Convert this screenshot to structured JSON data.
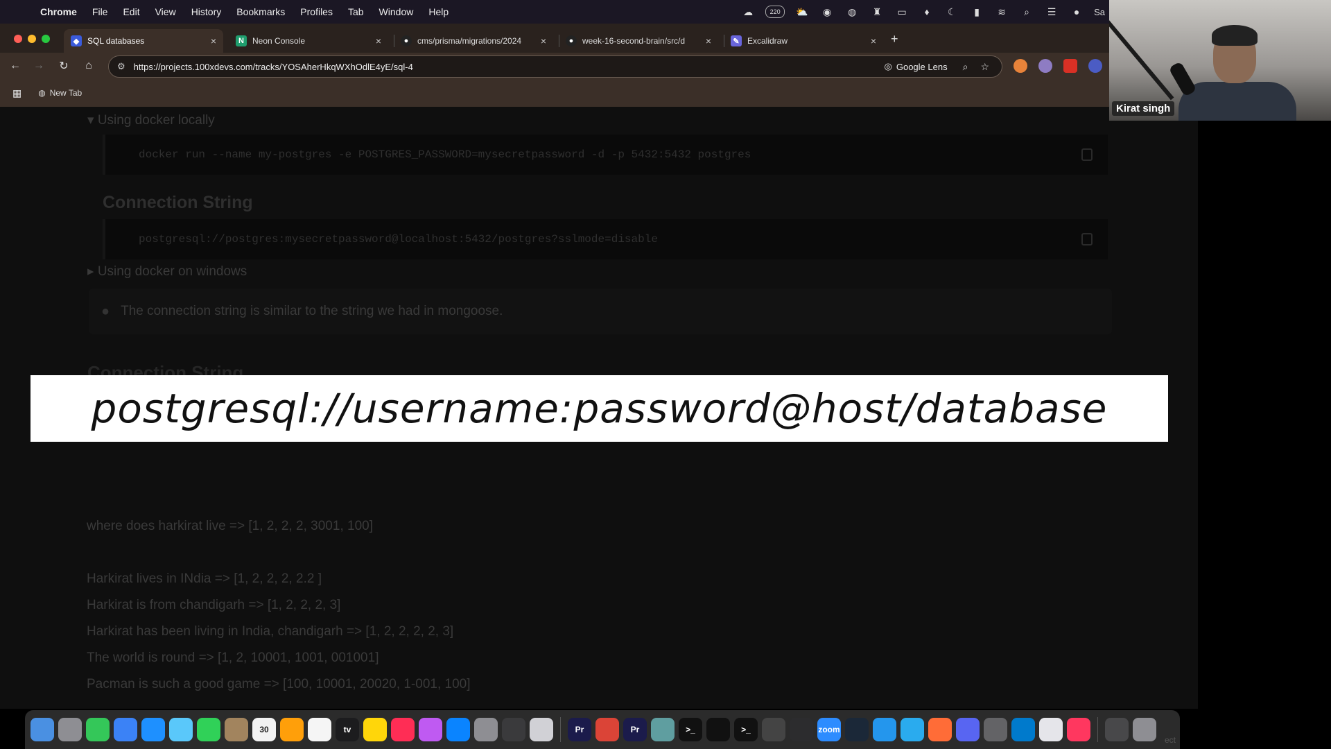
{
  "menubar": {
    "app": "Chrome",
    "items": [
      "File",
      "Edit",
      "View",
      "History",
      "Bookmarks",
      "Profiles",
      "Tab",
      "Window",
      "Help"
    ],
    "status_icons": [
      "cloud-icon",
      "badge-icon",
      "weather-icon",
      "eye-icon",
      "globe-icon",
      "puzzle-icon",
      "calendar-icon",
      "vpn-icon",
      "moon-icon",
      "battery-icon",
      "wifi-icon",
      "search-icon",
      "control-center-icon",
      "siri-icon"
    ],
    "status_badge": "220",
    "status_trailing": "Sa"
  },
  "tabs": [
    {
      "title": "SQL databases",
      "icon": "100xdevs-icon",
      "icon_color": "#3b5bdb",
      "active": true
    },
    {
      "title": "Neon Console",
      "icon": "neon-icon",
      "icon_color": "#1f9e6e",
      "active": false
    },
    {
      "title": "cms/prisma/migrations/2024",
      "icon": "github-icon",
      "icon_color": "#222222",
      "active": false
    },
    {
      "title": "week-16-second-brain/src/d",
      "icon": "github-icon",
      "icon_color": "#222222",
      "active": false
    },
    {
      "title": "Excalidraw",
      "icon": "excalidraw-icon",
      "icon_color": "#6965db",
      "active": false
    }
  ],
  "omnibox": {
    "url": "https://projects.100xdevs.com/tracks/YOSAherHkqWXhOdlE4yE/sql-4",
    "lens_label": "Google Lens"
  },
  "bookmarks": {
    "items": [
      "New Tab"
    ]
  },
  "page": {
    "toggle_docker_local": "Using docker locally",
    "docker_command": "docker run --name my-postgres -e POSTGRES_PASSWORD=mysecretpassword -d -p 5432:5432 postgres",
    "connection_string_heading": "Connection String",
    "connection_string_value": "postgresql://postgres:mysecretpassword@localhost:5432/postgres?sslmode=disable",
    "toggle_docker_windows": "Using docker on windows",
    "callout_text": "The connection string is similar to the string we had in mongoose.",
    "faded_heading": "Connection String",
    "banner_text": "postgresql://username:password@host/database",
    "embedding_lines": [
      "where does harkirat live => [1, 2, 2, 2, 3001, 100]",
      "Harkirat lives in INdia => [1, 2, 2, 2, 2.2 ]",
      "Harkirat is from chandigarh => [1, 2, 2, 2, 3]",
      "Harkirat has been living in India, chandigarh => [1, 2, 2, 2, 2, 3]",
      "The world is round => [1, 2, 10001, 1001, 001001]",
      "Pacman is such a good game => [100, 10001, 20020, 1-001, 100]"
    ]
  },
  "webcam": {
    "name": "Kirat singh"
  },
  "dock": {
    "calendar_day": "30",
    "bottom_text": "ect",
    "apps": [
      {
        "name": "finder-icon",
        "color": "#4a90e2",
        "label": ""
      },
      {
        "name": "launchpad-icon",
        "color": "#8e8e93",
        "label": ""
      },
      {
        "name": "messages-icon",
        "color": "#34c759",
        "label": ""
      },
      {
        "name": "mail-icon",
        "color": "#3b82f6",
        "label": ""
      },
      {
        "name": "safari-icon",
        "color": "#1e90ff",
        "label": ""
      },
      {
        "name": "maps-icon",
        "color": "#5ac8fa",
        "label": ""
      },
      {
        "name": "facetime-icon",
        "color": "#30d158",
        "label": ""
      },
      {
        "name": "contacts-icon",
        "color": "#a2845e",
        "label": ""
      },
      {
        "name": "calendar-icon",
        "color": "#f2f2f2",
        "label": "30"
      },
      {
        "name": "photos-icon",
        "color": "#ff9f0a",
        "label": ""
      },
      {
        "name": "reminders-icon",
        "color": "#f5f5f5",
        "label": ""
      },
      {
        "name": "apple-tv-icon",
        "color": "#1c1c1e",
        "label": "tv"
      },
      {
        "name": "notes-icon",
        "color": "#ffd60a",
        "label": ""
      },
      {
        "name": "music-icon",
        "color": "#ff2d55",
        "label": ""
      },
      {
        "name": "podcasts-icon",
        "color": "#bf5af2",
        "label": ""
      },
      {
        "name": "app-store-icon",
        "color": "#0a84ff",
        "label": ""
      },
      {
        "name": "system-settings-icon",
        "color": "#8e8e93",
        "label": ""
      },
      {
        "name": "activity-monitor-icon",
        "color": "#3a3a3c",
        "label": ""
      },
      {
        "name": "preview-icon",
        "color": "#d1d1d6",
        "label": ""
      },
      {
        "name": "premiere-pro-icon",
        "color": "#1b1b4b",
        "label": "Pr"
      },
      {
        "name": "chrome-icon",
        "color": "#db4437",
        "label": ""
      },
      {
        "name": "premiere-pro-2-icon",
        "color": "#1b1b4b",
        "label": "Pr"
      },
      {
        "name": "chromium-icon",
        "color": "#5f9ea0",
        "label": ""
      },
      {
        "name": "terminal-icon",
        "color": "#111111",
        "label": ">_"
      },
      {
        "name": "terminal-2-icon",
        "color": "#111111",
        "label": ""
      },
      {
        "name": "terminal-3-icon",
        "color": "#111111",
        "label": ">_"
      },
      {
        "name": "piano-icon",
        "color": "#444444",
        "label": ""
      },
      {
        "name": "console-icon",
        "color": "#2c2c2e",
        "label": ""
      },
      {
        "name": "zoom-icon",
        "color": "#2d8cff",
        "label": "zoom"
      },
      {
        "name": "steam-icon",
        "color": "#1b2838",
        "label": ""
      },
      {
        "name": "docker-icon",
        "color": "#2496ed",
        "label": ""
      },
      {
        "name": "telegram-icon",
        "color": "#2aabee",
        "label": ""
      },
      {
        "name": "postman-icon",
        "color": "#ff6c37",
        "label": ""
      },
      {
        "name": "discord-icon",
        "color": "#5865f2",
        "label": ""
      },
      {
        "name": "screen-icon",
        "color": "#636366",
        "label": ""
      },
      {
        "name": "vscode-icon",
        "color": "#007acc",
        "label": ""
      },
      {
        "name": "download-icon",
        "color": "#e5e5ea",
        "label": ""
      },
      {
        "name": "creative-cloud-icon",
        "color": "#ff375f",
        "label": ""
      },
      {
        "name": "finder-window-icon",
        "color": "#48484a",
        "label": ""
      },
      {
        "name": "trash-icon",
        "color": "#8e8e93",
        "label": ""
      }
    ]
  }
}
